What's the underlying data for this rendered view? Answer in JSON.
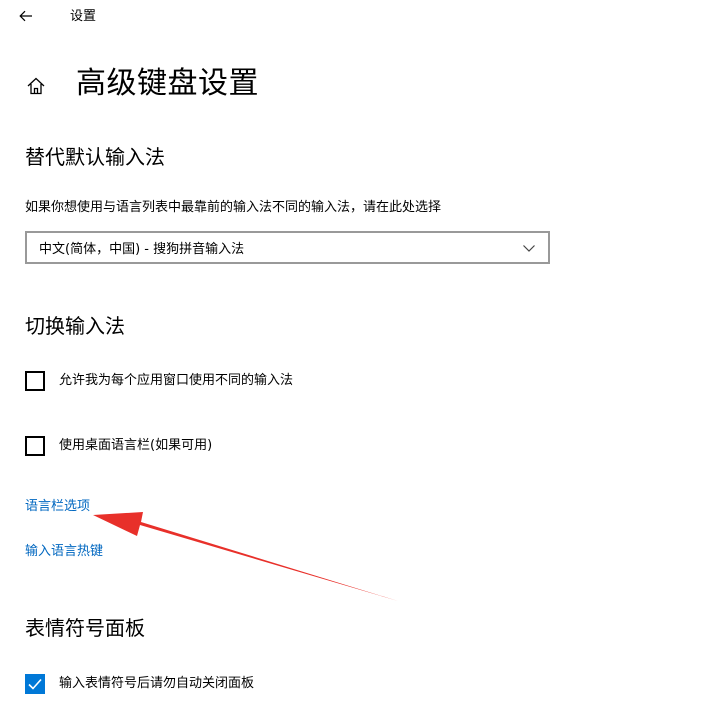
{
  "window": {
    "back_icon": "arrow-left-icon",
    "title": "设置"
  },
  "page": {
    "home_icon": "home-icon",
    "title": "高级键盘设置"
  },
  "override_input": {
    "heading": "替代默认输入法",
    "description": "如果你想使用与语言列表中最靠前的输入法不同的输入法，请在此处选择",
    "dropdown_value": "中文(简体，中国) - 搜狗拼音输入法",
    "dropdown_icon": "chevron-down-icon"
  },
  "switching": {
    "heading": "切换输入法",
    "options": [
      {
        "label": "允许我为每个应用窗口使用不同的输入法",
        "checked": false
      },
      {
        "label": "使用桌面语言栏(如果可用)",
        "checked": false
      }
    ],
    "links": [
      "语言栏选项",
      "输入语言热键"
    ]
  },
  "emoji": {
    "heading": "表情符号面板",
    "option": {
      "label": "输入表情符号后请勿自动关闭面板",
      "checked": true
    }
  },
  "annotation": {
    "arrow_color": "#e8302a"
  },
  "colors": {
    "accent": "#0078d7",
    "link": "#0067c0"
  }
}
